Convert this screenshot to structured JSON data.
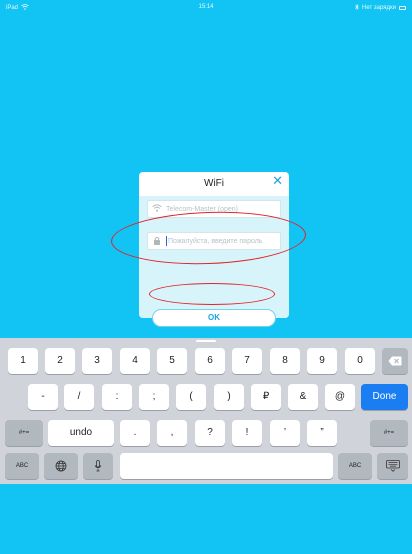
{
  "status_bar": {
    "device": "iPad",
    "wifi_icon": "wifi-icon",
    "time": "15:14",
    "charging_text": "Нет зарядки",
    "battery_icon": "battery-icon"
  },
  "dialog": {
    "title": "WiFi",
    "close_icon": "close-icon",
    "ssid_value": "Telecom-Master (open)",
    "password_placeholder": "Пожалуйста, введите пароль",
    "ok_label": "OK"
  },
  "keyboard": {
    "row1": [
      "1",
      "2",
      "3",
      "4",
      "5",
      "6",
      "7",
      "8",
      "9",
      "0"
    ],
    "delete_icon": "backspace-icon",
    "row2": [
      "-",
      "/",
      ":",
      ";",
      "(",
      ")",
      "₽",
      "&",
      "@"
    ],
    "return_label": "Done",
    "row3_left": "#+=",
    "undo_label": "undo",
    "row3": [
      ".",
      ",",
      "?",
      "!",
      "’",
      "”"
    ],
    "row3_right": "#+=",
    "abc_label": "ABC",
    "globe_icon": "globe-icon",
    "mic_icon": "microphone-icon",
    "abc_label_right": "ABC",
    "hide_icon": "keyboard-hide-icon"
  },
  "colors": {
    "background": "#12c4f4",
    "accent": "#1aa3e0",
    "annotation": "#e0232a",
    "done_key": "#1a7ef2"
  }
}
